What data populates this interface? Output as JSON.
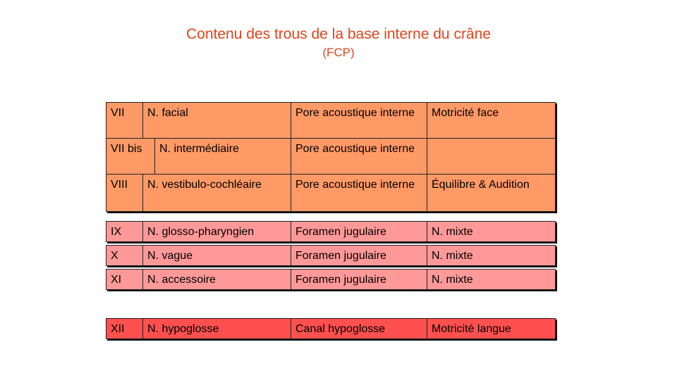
{
  "title": "Contenu des trous de la base interne du crâne",
  "subtitle": "(FCP)",
  "colors": {
    "title": "#e0441b",
    "group1": "#ff9966",
    "group2": "#ff9999",
    "group3": "#ff5050"
  },
  "rows": [
    {
      "num": "VII",
      "nerve": "N. facial",
      "foramen": "Pore acoustique interne",
      "function": "Motricité face"
    },
    {
      "num": "VII bis",
      "nerve": "N. intermédiaire",
      "foramen": "Pore acoustique interne",
      "function": ""
    },
    {
      "num": "VIII",
      "nerve": "N. vestibulo-cochléaire",
      "foramen": "Pore acoustique interne",
      "function": "Équilibre & Audition"
    },
    {
      "num": "IX",
      "nerve": "N. glosso-pharyngien",
      "foramen": "Foramen jugulaire",
      "function": "N. mixte"
    },
    {
      "num": "X",
      "nerve": "N. vague",
      "foramen": "Foramen jugulaire",
      "function": "N. mixte"
    },
    {
      "num": "XI",
      "nerve": "N. accessoire",
      "foramen": "Foramen jugulaire",
      "function": "N. mixte"
    },
    {
      "num": "XII",
      "nerve": "N. hypoglosse",
      "foramen": "Canal hypoglosse",
      "function": "Motricité langue"
    }
  ]
}
